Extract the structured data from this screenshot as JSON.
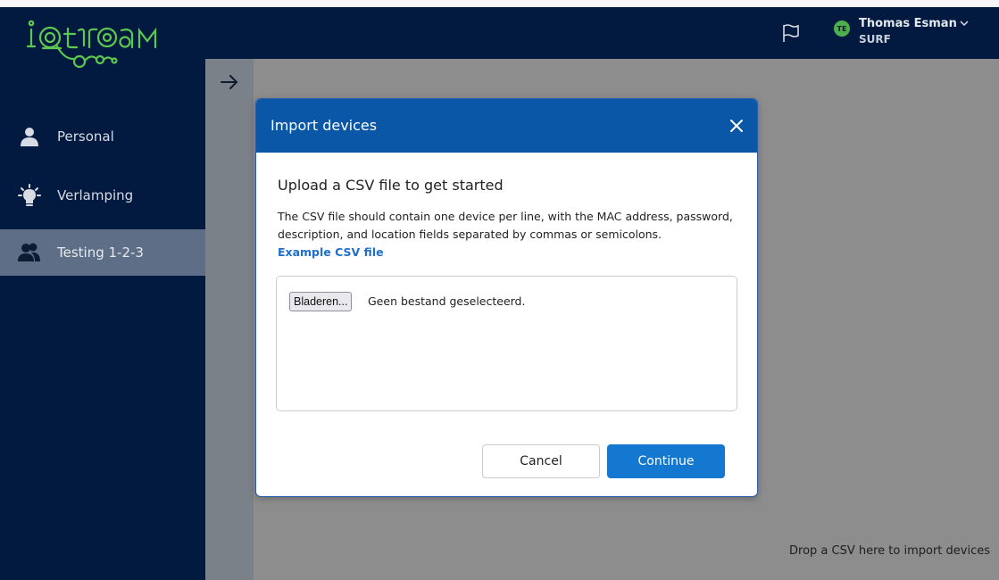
{
  "app": {
    "brand": "iotroam"
  },
  "sidebar": {
    "items": [
      {
        "label": "Personal",
        "icon": "person-icon"
      },
      {
        "label": "Verlamping",
        "icon": "lightbulb-icon"
      },
      {
        "label": "Testing 1-2-3",
        "icon": "group-icon"
      }
    ],
    "active_index": 2
  },
  "header": {
    "user_initials": "TE",
    "user_name": "Thomas Esman",
    "user_org": "SURF"
  },
  "main": {
    "drop_hint": "Drop a CSV here to import devices"
  },
  "modal": {
    "title": "Import devices",
    "subtitle": "Upload a CSV file to get started",
    "description": "The CSV file should contain one device per line, with the MAC address, password, description, and location fields separated by commas or semicolons.",
    "example_link": "Example CSV file",
    "browse_label": "Bladeren...",
    "file_status": "Geen bestand geselecteerd.",
    "cancel_label": "Cancel",
    "continue_label": "Continue"
  },
  "colors": {
    "sidebar_bg": "#031a40",
    "modal_header": "#0a56a7",
    "primary_button": "#1478d1",
    "link": "#1f6fcb",
    "logo_green": "#5cc84f",
    "avatar_green": "#4caf50"
  }
}
